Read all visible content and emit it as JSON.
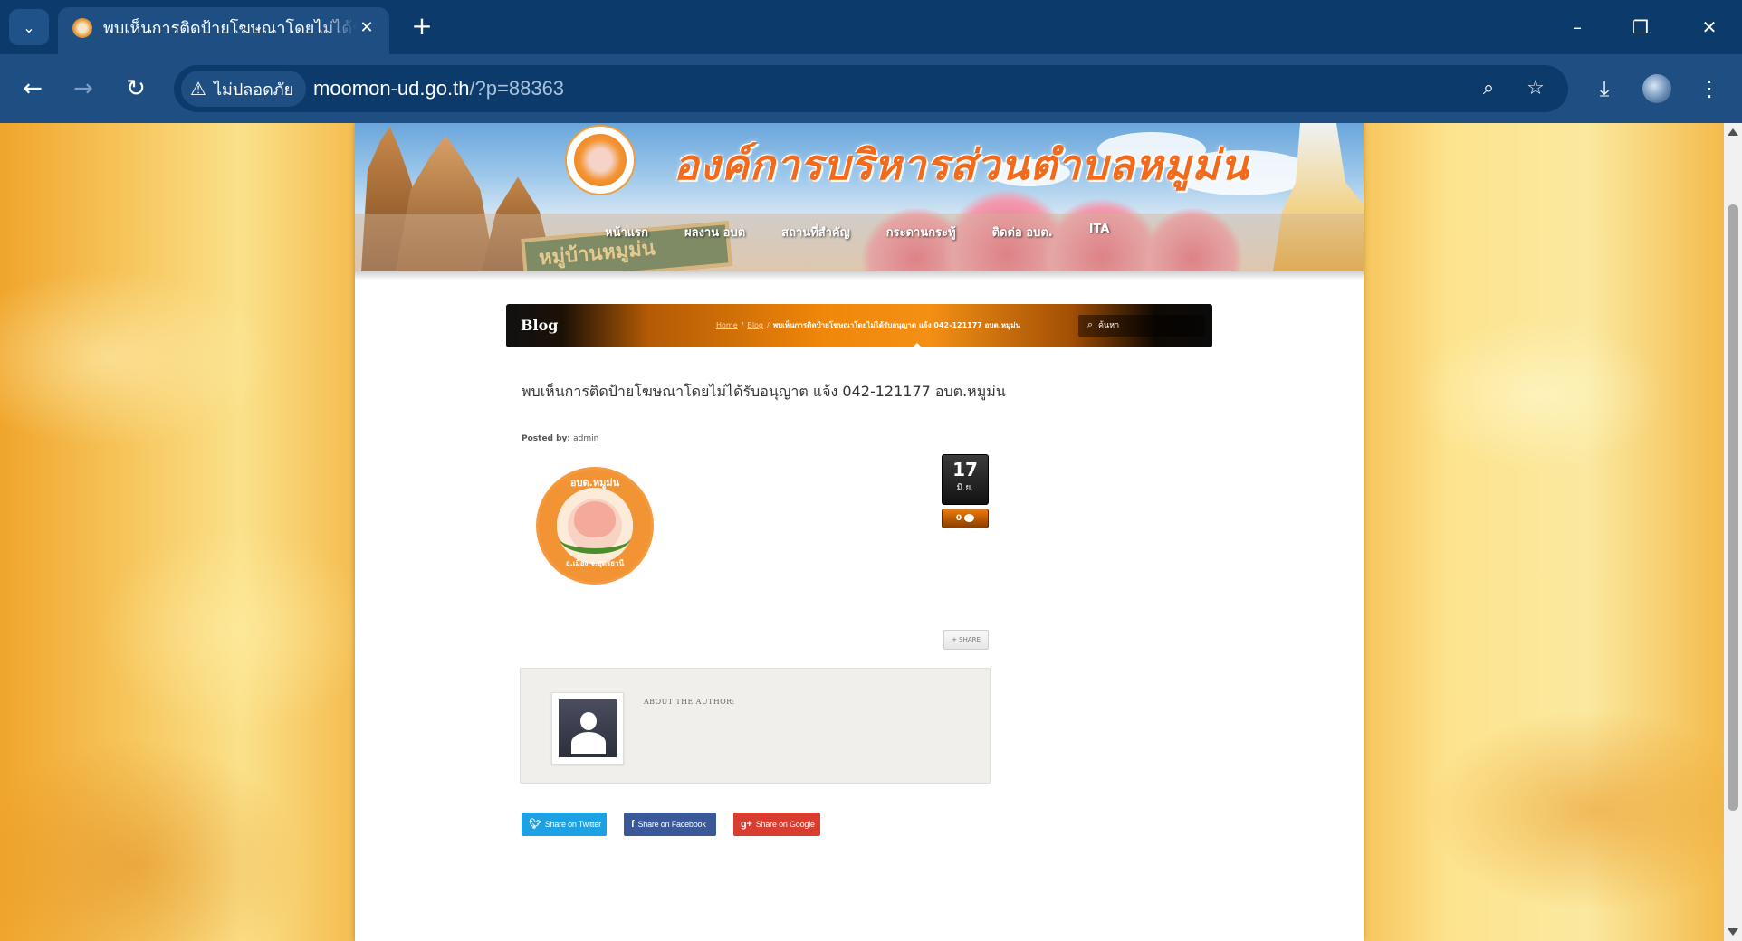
{
  "browser": {
    "tab_title": "พบเห็นการติดป้ายโฆษณาโดยไม่ได้รับอนุญาต แจ้ง 042-121177 อบต.หมูม่น",
    "security_label": "ไม่ปลอดภัย",
    "url_host": "moomon-ud.go.th",
    "url_rest": "/?p=88363",
    "icons": {
      "tab_menu": "chevron-down-icon",
      "tab_close": "close-icon",
      "new_tab": "plus-icon",
      "minimize": "minimize-icon",
      "restore": "restore-icon",
      "close": "close-icon",
      "back": "arrow-left-icon",
      "forward": "arrow-right-icon",
      "reload": "reload-icon",
      "warning": "warning-icon",
      "zoom": "zoom-icon",
      "bookmark": "star-icon",
      "download": "download-icon",
      "profile": "avatar-icon",
      "menu": "kebab-menu-icon"
    }
  },
  "site": {
    "title": "องค์การบริหารส่วนตำบลหมูม่น",
    "sign_text": "หมู่บ้านหมูม่น",
    "nav": [
      "หน้าแรก",
      "ผลงาน อบต",
      "สถานที่สำคัญ",
      "กระดานกระทู้",
      "ติดต่อ อบต.",
      "ITA"
    ]
  },
  "titlebar": {
    "section": "Blog",
    "crumbs": [
      "Home",
      "Blog"
    ],
    "current": "พบเห็นการติดป้ายโฆษณาโดยไม่ได้รับอนุญาต แจ้ง 042-121177 อบต.หมูม่น",
    "search_placeholder": "ค้นหา"
  },
  "post": {
    "title": "พบเห็นการติดป้ายโฆษณาโดยไม่ได้รับอนุญาต แจ้ง 042-121177 อบต.หมูม่น",
    "posted_by_label": "Posted by:",
    "author": "admin",
    "logo_top": "อบต.หมูม่น",
    "logo_bottom": "อ.เมือง จ.อุดรธานี",
    "date_day": "17",
    "date_month": "มิ.ย.",
    "comment_count": "0",
    "share_label": "+ SHARE",
    "about_author": "ABOUT THE AUTHOR:"
  },
  "social": {
    "twitter": "Share on Twitter",
    "facebook": "Share on Facebook",
    "google": "Share on Google"
  },
  "colors": {
    "chrome_dark": "#0b3a6b",
    "chrome_mid": "#1f4f82",
    "accent_orange": "#f0870a",
    "twitter": "#1da1e2",
    "facebook": "#3b5998",
    "google": "#d93d2f"
  }
}
